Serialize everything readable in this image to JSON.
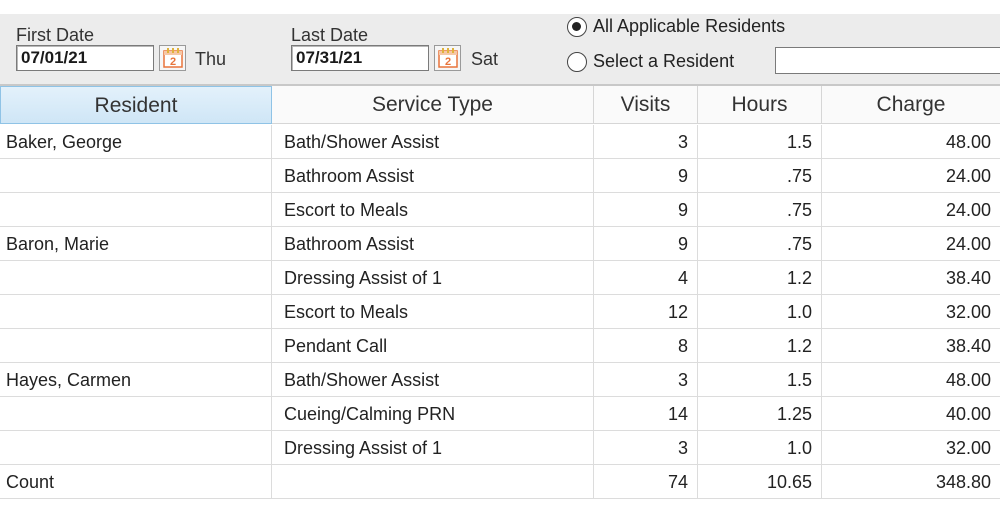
{
  "filters": {
    "first_date_label": "First Date",
    "first_date_value": "07/01/21",
    "first_day": "Thu",
    "last_date_label": "Last Date",
    "last_date_value": "07/31/21",
    "last_day": "Sat",
    "calendar_icon_text": "2",
    "radio_all_label": "All Applicable Residents",
    "radio_select_label": "Select a Resident",
    "selected_radio": "all",
    "resident_input_value": ""
  },
  "table": {
    "columns": [
      "Resident",
      "Service Type",
      "Visits",
      "Hours",
      "Charge"
    ],
    "rows": [
      {
        "resident": "Baker, George",
        "service": "Bath/Shower Assist",
        "visits": "3",
        "hours": "1.5",
        "charge": "48.00"
      },
      {
        "resident": "",
        "service": "Bathroom Assist",
        "visits": "9",
        "hours": ".75",
        "charge": "24.00"
      },
      {
        "resident": "",
        "service": "Escort to Meals",
        "visits": "9",
        "hours": ".75",
        "charge": "24.00"
      },
      {
        "resident": "Baron, Marie",
        "service": "Bathroom Assist",
        "visits": "9",
        "hours": ".75",
        "charge": "24.00"
      },
      {
        "resident": "",
        "service": "Dressing Assist of 1",
        "visits": "4",
        "hours": "1.2",
        "charge": "38.40"
      },
      {
        "resident": "",
        "service": "Escort to Meals",
        "visits": "12",
        "hours": "1.0",
        "charge": "32.00"
      },
      {
        "resident": "",
        "service": "Pendant Call",
        "visits": "8",
        "hours": "1.2",
        "charge": "38.40"
      },
      {
        "resident": "Hayes, Carmen",
        "service": "Bath/Shower Assist",
        "visits": "3",
        "hours": "1.5",
        "charge": "48.00"
      },
      {
        "resident": "",
        "service": "Cueing/Calming PRN",
        "visits": "14",
        "hours": "1.25",
        "charge": "40.00"
      },
      {
        "resident": "",
        "service": "Dressing Assist of 1",
        "visits": "3",
        "hours": "1.0",
        "charge": "32.00"
      }
    ],
    "footer": {
      "resident": "Count",
      "service": "",
      "visits": "74",
      "hours": "10.65",
      "charge": "348.80"
    }
  },
  "colors": {
    "header_selected_bg": "#cfe6f6",
    "header_selected_border": "#8fc3e6",
    "calendar_accent": "#e8743b",
    "calendar_spiral": "#e0b23a"
  },
  "icons": {
    "calendar": "calendar-icon",
    "radio_on": "radio-selected",
    "radio_off": "radio-unselected"
  }
}
